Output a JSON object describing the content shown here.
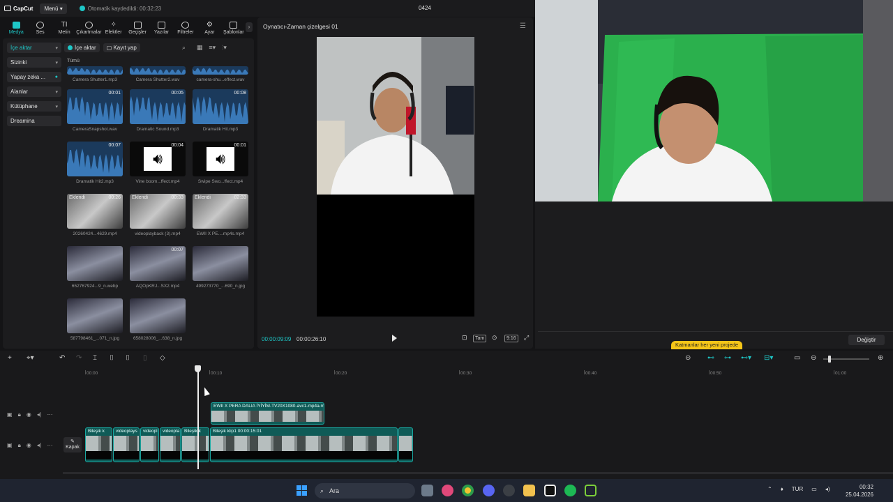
{
  "titlebar": {
    "logo": "CapCut",
    "menu": "Menü",
    "autosave": "Otomatik kaydedildi: 00:32:23",
    "project_name": "0424"
  },
  "toolbar": {
    "tools": [
      {
        "label": "Medya",
        "active": true
      },
      {
        "label": "Ses"
      },
      {
        "label": "Metin"
      },
      {
        "label": "Çıkartmalar"
      },
      {
        "label": "Efektler"
      },
      {
        "label": "Geçişler"
      },
      {
        "label": "Yazılar"
      },
      {
        "label": "Filtreler"
      },
      {
        "label": "Ayar"
      },
      {
        "label": "Şablonlar"
      }
    ]
  },
  "sidebar": {
    "items": [
      {
        "label": "İçe aktar",
        "active": true
      },
      {
        "label": "Sizinki"
      },
      {
        "label": "Yapay zeka ..."
      },
      {
        "label": "Alanlar"
      },
      {
        "label": "Kütüphane"
      },
      {
        "label": "Dreamina"
      }
    ]
  },
  "media": {
    "import_label": "İçe aktar",
    "record_label": "Kayıt yap",
    "tab_all": "Tümü",
    "items": [
      {
        "name": "Camera Shutter1.mp3",
        "kind": "audio"
      },
      {
        "name": "Camera Shutter2.wav",
        "kind": "audio"
      },
      {
        "name": "camera-shu...effect.wav",
        "kind": "audio"
      },
      {
        "name": "CameraSnapshot.wav",
        "kind": "audio",
        "dur": "00:01"
      },
      {
        "name": "Dramatic Sound.mp3",
        "kind": "audio",
        "dur": "00:05"
      },
      {
        "name": "Dramatik Hit.mp3",
        "kind": "audio",
        "dur": "00:08"
      },
      {
        "name": "Dramatik Hit2.mp3",
        "kind": "audio",
        "dur": "00:07"
      },
      {
        "name": "Vine boom...ffect.mp4",
        "kind": "speaker",
        "dur": "00:04"
      },
      {
        "name": "Swipe Swo...ffect.mp4",
        "kind": "speaker",
        "dur": "00:01"
      },
      {
        "name": "20260424...4629.mp4",
        "kind": "video",
        "badge": "Eklendi",
        "dur": "00:26"
      },
      {
        "name": "videoplayback (3).mp4",
        "kind": "video",
        "badge": "Eklendi",
        "dur": "00:33"
      },
      {
        "name": "EWII X PE....mp4s.mp4",
        "kind": "video",
        "badge": "Eklendi",
        "dur": "02:33"
      },
      {
        "name": "652767924...9_n.webp",
        "kind": "image"
      },
      {
        "name": "AQOpKRJ...SX2.mp4",
        "kind": "image",
        "dur": "00:07"
      },
      {
        "name": "499273770_...690_n.jpg",
        "kind": "image"
      },
      {
        "name": "587798461_...071_n.jpg",
        "kind": "image"
      },
      {
        "name": "658028006_...638_n.jpg",
        "kind": "image"
      }
    ]
  },
  "player": {
    "title": "Oynatıcı-Zaman çizelgesi 01",
    "current_time": "00:00:09:09",
    "total_time": "00:00:26:10",
    "full_label": "Tam",
    "ratio_label": "9:16"
  },
  "right_panel": {
    "tooltip": "Katmanlar her yeni projede",
    "change_button": "Değiştir"
  },
  "timeline": {
    "ruler": [
      "00:00",
      "00:10",
      "00:20",
      "00:30",
      "00:40",
      "00:50",
      "01:00"
    ],
    "cover_label": "Kapak",
    "overlay_clip_label": "EWII X PERA DALIA İYİYİM-TV20X1080-avc1-mp4a.m",
    "main_clips": [
      {
        "label": "Bileşik k"
      },
      {
        "label": "videoplays"
      },
      {
        "label": "videopl"
      },
      {
        "label": "videopla"
      },
      {
        "label": "Bileşik k"
      },
      {
        "label": "Bileşik klip1  00:00:15:01"
      },
      {
        "label": ""
      }
    ]
  },
  "taskbar": {
    "search_placeholder": "Ara",
    "lang": "TUR",
    "time": "00:32",
    "date": "25.04.2026"
  },
  "colors": {
    "accent": "#1ec7c7",
    "clip": "#0f5b57",
    "tooltip": "#f5c518"
  }
}
